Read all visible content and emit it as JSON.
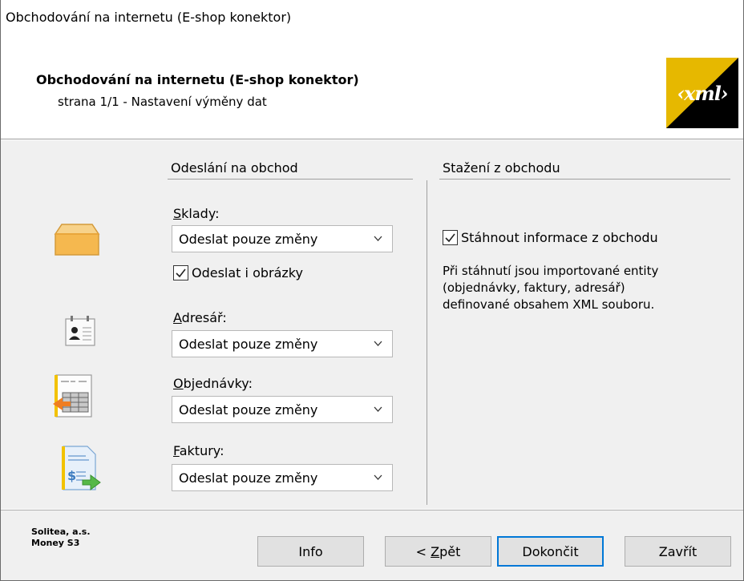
{
  "window": {
    "title": "Obchodování na internetu (E-shop konektor)"
  },
  "header": {
    "title": "Obchodování na internetu (E-shop konektor)",
    "subtitle": "strana 1/1 - Nastavení výměny dat",
    "logo_text": "‹xml›"
  },
  "left_section": {
    "heading": "Odeslání na obchod",
    "groups": [
      {
        "label_first": "S",
        "label_rest": "klady:",
        "value": "Odeslat pouze změny",
        "icon": "warehouse-box-icon"
      },
      {
        "label_first": "A",
        "label_rest": "dresář:",
        "value": "Odeslat pouze změny",
        "icon": "address-book-icon"
      },
      {
        "label_first": "O",
        "label_rest": "bjednávky:",
        "value": "Odeslat pouze změny",
        "icon": "orders-icon"
      },
      {
        "label_first": "F",
        "label_rest": "aktury:",
        "value": "Odeslat pouze změny",
        "icon": "invoice-icon"
      }
    ],
    "send_images": {
      "label": "Odeslat i obrázky",
      "checked": true
    }
  },
  "right_section": {
    "heading": "Stažení z obchodu",
    "download": {
      "label": "Stáhnout informace z obchodu",
      "checked": true
    },
    "description": [
      "Při stáhnutí jsou importované entity",
      "(objednávky, faktury, adresář)",
      "definované obsahem XML souboru."
    ]
  },
  "footer": {
    "company_line1": "Solitea, a.s.",
    "company_line2": "Money S3",
    "buttons": {
      "info": "Info",
      "back_prefix": "< ",
      "back_first": "Z",
      "back_rest": "pět",
      "finish": "Dokončit",
      "close": "Zavřít"
    }
  },
  "colors": {
    "accent": "#0078d7",
    "panel": "#f0f0f0",
    "logo_yellow": "#f2c200"
  }
}
